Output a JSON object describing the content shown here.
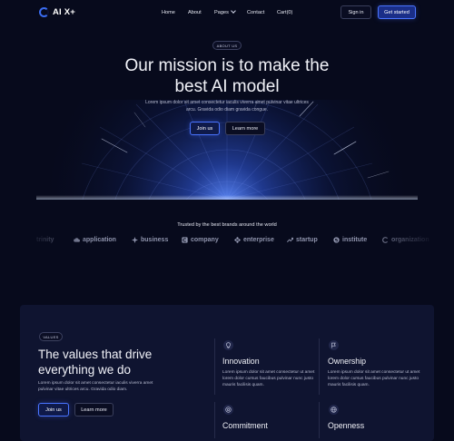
{
  "nav": {
    "logo_text": "AI X+",
    "links": [
      "Home",
      "About",
      "Pages",
      "Contact",
      "Cart(0)"
    ],
    "signin_label": "Sign in",
    "get_started_label": "Get started"
  },
  "hero": {
    "badge": "ABOUT US",
    "title_line1": "Our mission is to make the",
    "title_line2": "best AI model",
    "subtitle": "Lorem ipsum dolor sit amet consectetur iaculis viverra amet pulvinar vitae ultrices arcu. Gravida odio diam gravida congue.",
    "join_label": "Join us",
    "learn_label": "Learn more"
  },
  "brands": {
    "heading": "Trusted by the best brands around the world",
    "items": [
      {
        "name": "trinity",
        "icon": "partial-logo"
      },
      {
        "name": "application",
        "icon": "cloud-icon"
      },
      {
        "name": "business",
        "icon": "cross-star-icon"
      },
      {
        "name": "company",
        "icon": "square-c-icon"
      },
      {
        "name": "enterprise",
        "icon": "diamond-grid-icon"
      },
      {
        "name": "startup",
        "icon": "trend-icon"
      },
      {
        "name": "institute",
        "icon": "circle-s-icon"
      },
      {
        "name": "organization",
        "icon": "partial-logo"
      }
    ]
  },
  "values": {
    "badge": "VALUES",
    "title": "The values that drive everything we do",
    "description": "Lorem ipsum dolor sit amet consectetur iaculis viverra amet pulvinar vitae ultrices arcu. Gravida odio diam.",
    "join_label": "Join us",
    "learn_label": "Learn more",
    "items": [
      {
        "title": "Innovation",
        "text": "Lorem ipsum dolor sit amet consectetur ut amet lorem dolor cursus faucibus pulvinar nunc justo mauris facilisis quam.",
        "icon": "lightbulb-icon"
      },
      {
        "title": "Ownership",
        "text": "Lorem ipsum dolor sit amet consectetur ut amet lorem dolor cursus faucibus pulvinar nunc justo mauris facilisis quam.",
        "icon": "flag-icon"
      },
      {
        "title": "Commitment",
        "text": "",
        "icon": "target-icon"
      },
      {
        "title": "Openness",
        "text": "",
        "icon": "globe-icon"
      }
    ]
  },
  "colors": {
    "background": "#070a1c",
    "accent": "#3a6cf0",
    "card": "#0f1430"
  }
}
